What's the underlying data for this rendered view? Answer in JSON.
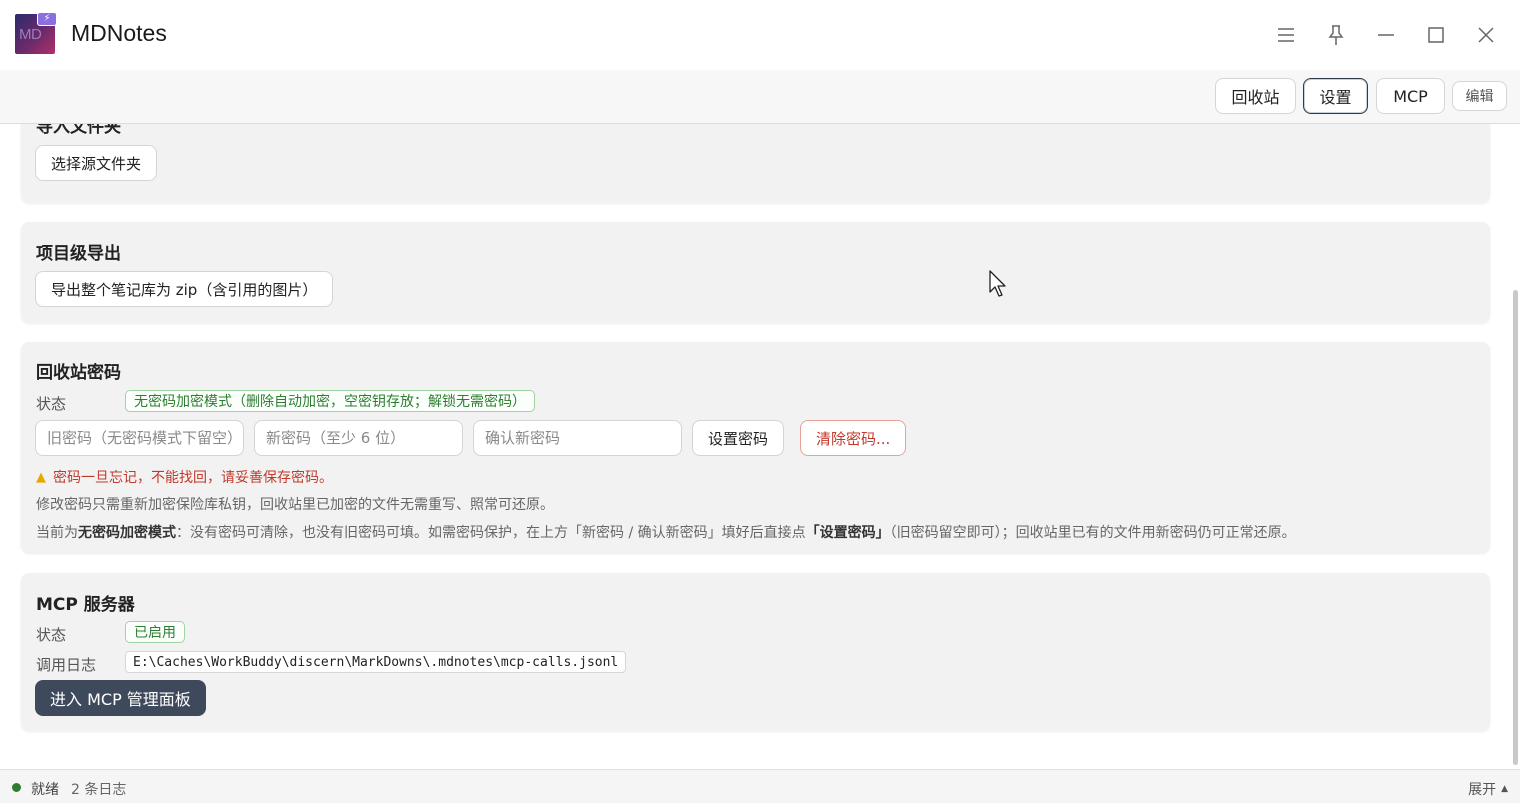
{
  "app": {
    "title": "MDNotes",
    "logo_text": "MD"
  },
  "toolbar": {
    "recycle": "回收站",
    "settings": "设置",
    "mcp": "MCP",
    "edit": "编辑"
  },
  "import_card": {
    "title_partial": "导入文件夹",
    "choose_button": "选择源文件夹"
  },
  "export_card": {
    "title": "项目级导出",
    "export_button": "导出整个笔记库为 zip（含引用的图片）"
  },
  "recycle_password": {
    "title": "回收站密码",
    "status_label": "状态",
    "status_value": "无密码加密模式（删除自动加密，空密钥存放；解锁无需密码）",
    "old_password_placeholder": "旧密码（无密码模式下留空）",
    "new_password_placeholder": "新密码（至少 6 位）",
    "confirm_password_placeholder": "确认新密码",
    "set_button": "设置密码",
    "clear_button": "清除密码...",
    "warning": "密码一旦忘记，不能找回，请妥善保存密码。",
    "note1": "修改密码只需重新加密保险库私钥，回收站里已加密的文件无需重写、照常可还原。",
    "note2_prefix": "当前为",
    "note2_bold1": "无密码加密模式",
    "note2_mid": "：没有密码可清除，也没有旧密码可填。如需密码保护，在上方「新密码 / 确认新密码」填好后直接点",
    "note2_bold2": "「设置密码」",
    "note2_suffix": "（旧密码留空即可）；回收站里已有的文件用新密码仍可正常还原。"
  },
  "mcp_card": {
    "title": "MCP 服务器",
    "status_label": "状态",
    "status_value": "已启用",
    "log_label": "调用日志",
    "log_path": "E:\\Caches\\WorkBuddy\\discern\\MarkDowns\\.mdnotes\\mcp-calls.jsonl",
    "panel_button": "进入 MCP 管理面板"
  },
  "statusbar": {
    "status": "就绪",
    "log_count": "2 条日志",
    "expand": "展开"
  },
  "colors": {
    "accent_dark": "#3e4a5c",
    "success": "#2e7d32",
    "danger": "#c0392b",
    "card_bg": "#f2f2f2"
  },
  "icons": {
    "menu": "menu-icon",
    "pin": "pin-icon",
    "minimize": "minimize-icon",
    "maximize": "maximize-icon",
    "close": "close-icon",
    "warning": "warning-icon"
  }
}
